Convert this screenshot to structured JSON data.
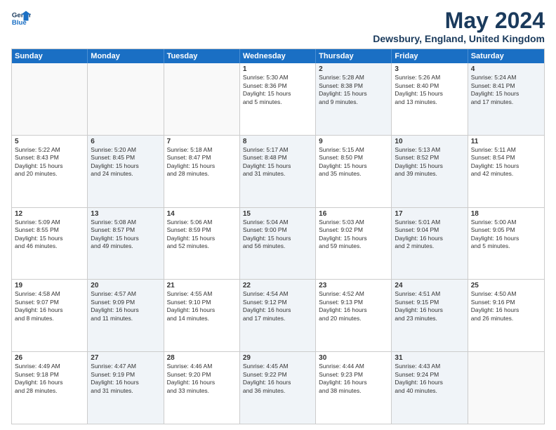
{
  "header": {
    "logo_line1": "General",
    "logo_line2": "Blue",
    "month_title": "May 2024",
    "location": "Dewsbury, England, United Kingdom"
  },
  "weekdays": [
    "Sunday",
    "Monday",
    "Tuesday",
    "Wednesday",
    "Thursday",
    "Friday",
    "Saturday"
  ],
  "weeks": [
    [
      {
        "day": "",
        "info": "",
        "shaded": false,
        "empty": true
      },
      {
        "day": "",
        "info": "",
        "shaded": false,
        "empty": true
      },
      {
        "day": "",
        "info": "",
        "shaded": false,
        "empty": true
      },
      {
        "day": "1",
        "info": "Sunrise: 5:30 AM\nSunset: 8:36 PM\nDaylight: 15 hours\nand 5 minutes.",
        "shaded": false,
        "empty": false
      },
      {
        "day": "2",
        "info": "Sunrise: 5:28 AM\nSunset: 8:38 PM\nDaylight: 15 hours\nand 9 minutes.",
        "shaded": true,
        "empty": false
      },
      {
        "day": "3",
        "info": "Sunrise: 5:26 AM\nSunset: 8:40 PM\nDaylight: 15 hours\nand 13 minutes.",
        "shaded": false,
        "empty": false
      },
      {
        "day": "4",
        "info": "Sunrise: 5:24 AM\nSunset: 8:41 PM\nDaylight: 15 hours\nand 17 minutes.",
        "shaded": true,
        "empty": false
      }
    ],
    [
      {
        "day": "5",
        "info": "Sunrise: 5:22 AM\nSunset: 8:43 PM\nDaylight: 15 hours\nand 20 minutes.",
        "shaded": false,
        "empty": false
      },
      {
        "day": "6",
        "info": "Sunrise: 5:20 AM\nSunset: 8:45 PM\nDaylight: 15 hours\nand 24 minutes.",
        "shaded": true,
        "empty": false
      },
      {
        "day": "7",
        "info": "Sunrise: 5:18 AM\nSunset: 8:47 PM\nDaylight: 15 hours\nand 28 minutes.",
        "shaded": false,
        "empty": false
      },
      {
        "day": "8",
        "info": "Sunrise: 5:17 AM\nSunset: 8:48 PM\nDaylight: 15 hours\nand 31 minutes.",
        "shaded": true,
        "empty": false
      },
      {
        "day": "9",
        "info": "Sunrise: 5:15 AM\nSunset: 8:50 PM\nDaylight: 15 hours\nand 35 minutes.",
        "shaded": false,
        "empty": false
      },
      {
        "day": "10",
        "info": "Sunrise: 5:13 AM\nSunset: 8:52 PM\nDaylight: 15 hours\nand 39 minutes.",
        "shaded": true,
        "empty": false
      },
      {
        "day": "11",
        "info": "Sunrise: 5:11 AM\nSunset: 8:54 PM\nDaylight: 15 hours\nand 42 minutes.",
        "shaded": false,
        "empty": false
      }
    ],
    [
      {
        "day": "12",
        "info": "Sunrise: 5:09 AM\nSunset: 8:55 PM\nDaylight: 15 hours\nand 46 minutes.",
        "shaded": false,
        "empty": false
      },
      {
        "day": "13",
        "info": "Sunrise: 5:08 AM\nSunset: 8:57 PM\nDaylight: 15 hours\nand 49 minutes.",
        "shaded": true,
        "empty": false
      },
      {
        "day": "14",
        "info": "Sunrise: 5:06 AM\nSunset: 8:59 PM\nDaylight: 15 hours\nand 52 minutes.",
        "shaded": false,
        "empty": false
      },
      {
        "day": "15",
        "info": "Sunrise: 5:04 AM\nSunset: 9:00 PM\nDaylight: 15 hours\nand 56 minutes.",
        "shaded": true,
        "empty": false
      },
      {
        "day": "16",
        "info": "Sunrise: 5:03 AM\nSunset: 9:02 PM\nDaylight: 15 hours\nand 59 minutes.",
        "shaded": false,
        "empty": false
      },
      {
        "day": "17",
        "info": "Sunrise: 5:01 AM\nSunset: 9:04 PM\nDaylight: 16 hours\nand 2 minutes.",
        "shaded": true,
        "empty": false
      },
      {
        "day": "18",
        "info": "Sunrise: 5:00 AM\nSunset: 9:05 PM\nDaylight: 16 hours\nand 5 minutes.",
        "shaded": false,
        "empty": false
      }
    ],
    [
      {
        "day": "19",
        "info": "Sunrise: 4:58 AM\nSunset: 9:07 PM\nDaylight: 16 hours\nand 8 minutes.",
        "shaded": false,
        "empty": false
      },
      {
        "day": "20",
        "info": "Sunrise: 4:57 AM\nSunset: 9:09 PM\nDaylight: 16 hours\nand 11 minutes.",
        "shaded": true,
        "empty": false
      },
      {
        "day": "21",
        "info": "Sunrise: 4:55 AM\nSunset: 9:10 PM\nDaylight: 16 hours\nand 14 minutes.",
        "shaded": false,
        "empty": false
      },
      {
        "day": "22",
        "info": "Sunrise: 4:54 AM\nSunset: 9:12 PM\nDaylight: 16 hours\nand 17 minutes.",
        "shaded": true,
        "empty": false
      },
      {
        "day": "23",
        "info": "Sunrise: 4:52 AM\nSunset: 9:13 PM\nDaylight: 16 hours\nand 20 minutes.",
        "shaded": false,
        "empty": false
      },
      {
        "day": "24",
        "info": "Sunrise: 4:51 AM\nSunset: 9:15 PM\nDaylight: 16 hours\nand 23 minutes.",
        "shaded": true,
        "empty": false
      },
      {
        "day": "25",
        "info": "Sunrise: 4:50 AM\nSunset: 9:16 PM\nDaylight: 16 hours\nand 26 minutes.",
        "shaded": false,
        "empty": false
      }
    ],
    [
      {
        "day": "26",
        "info": "Sunrise: 4:49 AM\nSunset: 9:18 PM\nDaylight: 16 hours\nand 28 minutes.",
        "shaded": false,
        "empty": false
      },
      {
        "day": "27",
        "info": "Sunrise: 4:47 AM\nSunset: 9:19 PM\nDaylight: 16 hours\nand 31 minutes.",
        "shaded": true,
        "empty": false
      },
      {
        "day": "28",
        "info": "Sunrise: 4:46 AM\nSunset: 9:20 PM\nDaylight: 16 hours\nand 33 minutes.",
        "shaded": false,
        "empty": false
      },
      {
        "day": "29",
        "info": "Sunrise: 4:45 AM\nSunset: 9:22 PM\nDaylight: 16 hours\nand 36 minutes.",
        "shaded": true,
        "empty": false
      },
      {
        "day": "30",
        "info": "Sunrise: 4:44 AM\nSunset: 9:23 PM\nDaylight: 16 hours\nand 38 minutes.",
        "shaded": false,
        "empty": false
      },
      {
        "day": "31",
        "info": "Sunrise: 4:43 AM\nSunset: 9:24 PM\nDaylight: 16 hours\nand 40 minutes.",
        "shaded": true,
        "empty": false
      },
      {
        "day": "",
        "info": "",
        "shaded": false,
        "empty": true
      }
    ]
  ]
}
